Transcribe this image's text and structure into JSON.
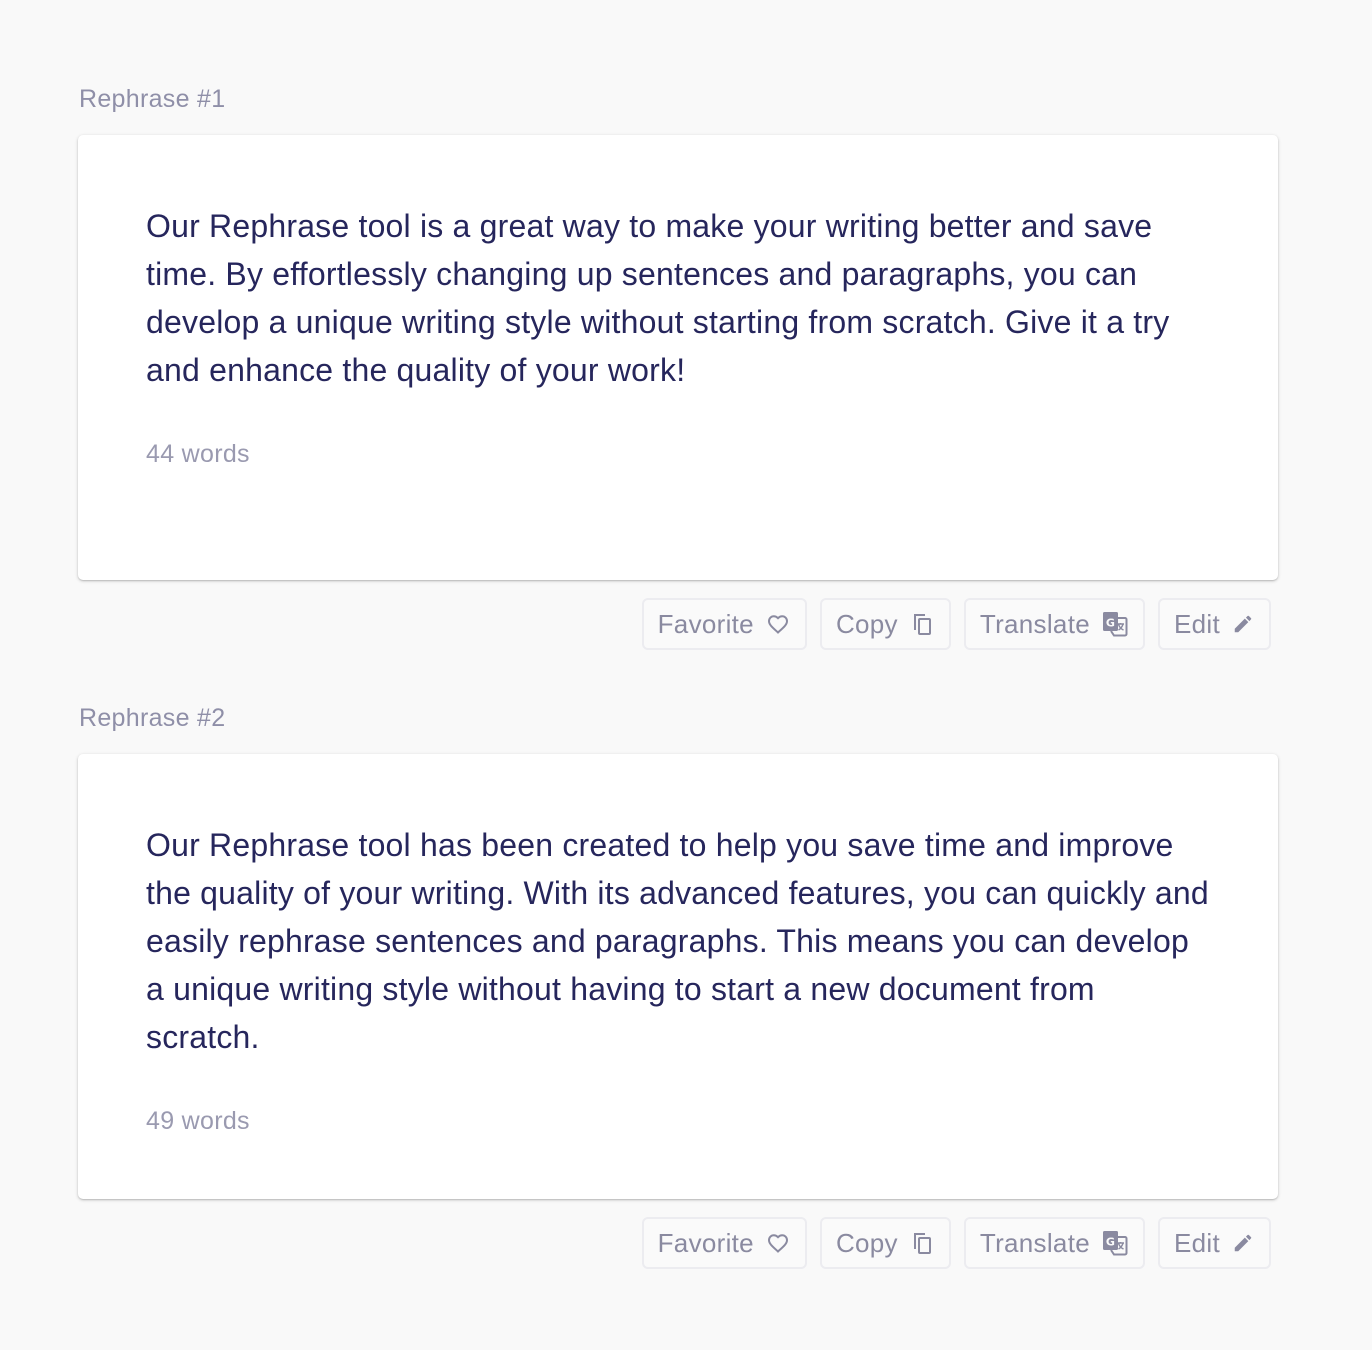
{
  "results": [
    {
      "label": "Rephrase #1",
      "text": "Our Rephrase tool is a great way to make your writing better and save time. By effortlessly changing up sentences and paragraphs, you can develop a unique writing style without starting from scratch. Give it a try and enhance the quality of your work!",
      "word_count": "44 words",
      "actions": {
        "favorite": "Favorite",
        "copy": "Copy",
        "translate": "Translate",
        "edit": "Edit"
      }
    },
    {
      "label": "Rephrase #2",
      "text": "Our Rephrase tool has been created to help you save time and improve the quality of your writing. With its advanced features, you can quickly and easily rephrase sentences and paragraphs. This means you can develop a unique writing style without having to start a new document from scratch.",
      "word_count": "49 words",
      "actions": {
        "favorite": "Favorite",
        "copy": "Copy",
        "translate": "Translate",
        "edit": "Edit"
      }
    }
  ],
  "icons": {
    "favorite": "heart-outline-icon",
    "copy": "copy-icon",
    "translate": "google-translate-icon",
    "edit": "pencil-icon"
  },
  "colors": {
    "background": "#f9f9f9",
    "text": "#26265c",
    "muted": "#8f8fa8"
  }
}
